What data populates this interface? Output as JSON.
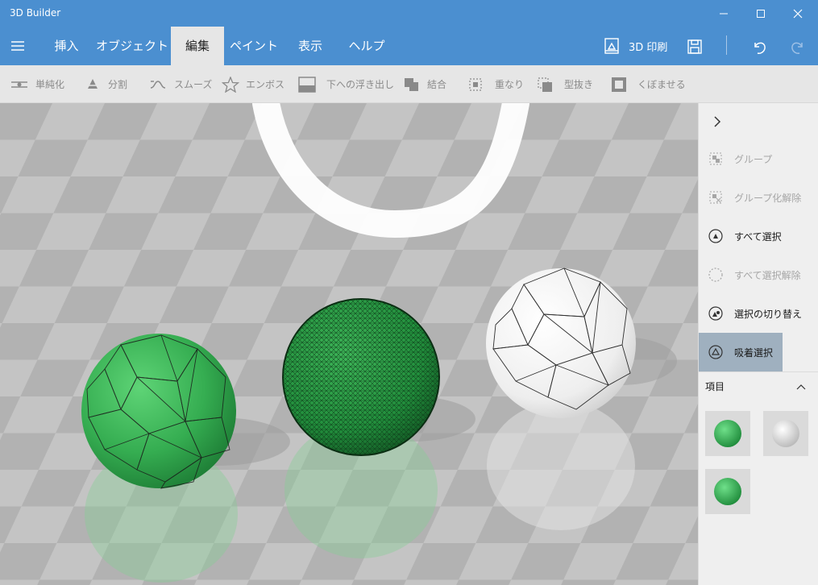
{
  "app": {
    "title": "3D Builder"
  },
  "menu": {
    "tabs": [
      {
        "label": "挿入"
      },
      {
        "label": "オブジェクト"
      },
      {
        "label": "編集"
      },
      {
        "label": "ペイント"
      },
      {
        "label": "表示"
      },
      {
        "label": "ヘルプ"
      }
    ],
    "active_tab": "編集",
    "print_label": "3D 印刷"
  },
  "toolbar": {
    "tools": [
      {
        "label": "単純化",
        "icon": "simplify-icon"
      },
      {
        "label": "分割",
        "icon": "split-icon"
      },
      {
        "label": "スムーズ",
        "icon": "smooth-icon"
      },
      {
        "label": "エンボス",
        "icon": "emboss-star-icon"
      },
      {
        "label": "下への浮き出し",
        "icon": "extrude-down-icon"
      },
      {
        "label": "結合",
        "icon": "merge-icon"
      },
      {
        "label": "重なり",
        "icon": "intersect-icon"
      },
      {
        "label": "型抜き",
        "icon": "subtract-icon"
      },
      {
        "label": "くぼませる",
        "icon": "hollow-icon"
      }
    ]
  },
  "panel": {
    "items": [
      {
        "label": "グループ",
        "icon": "group-icon",
        "state": "disabled"
      },
      {
        "label": "グループ化解除",
        "icon": "ungroup-icon",
        "state": "disabled"
      },
      {
        "label": "すべて選択",
        "icon": "select-all-icon",
        "state": "enabled"
      },
      {
        "label": "すべて選択解除",
        "icon": "deselect-all-icon",
        "state": "disabled"
      },
      {
        "label": "選択の切り替え",
        "icon": "invert-selection-icon",
        "state": "enabled"
      },
      {
        "label": "吸着選択",
        "icon": "snap-selection-icon",
        "state": "active"
      }
    ],
    "section_title": "項目",
    "thumbnails": [
      {
        "name": "green-sphere",
        "color": "#2fa84f"
      },
      {
        "name": "white-sphere",
        "color": "#e8e8e8"
      },
      {
        "name": "green-sphere",
        "color": "#2fa84f"
      }
    ]
  },
  "colors": {
    "titlebar": "#4b8fd0",
    "active_tab_bg": "#e6e6e6",
    "toolbar_bg": "#e6e6e6",
    "sphere_green": "#3fb85a",
    "sphere_dark_green": "#1f8f3c",
    "sphere_white": "#f4f4f4"
  }
}
